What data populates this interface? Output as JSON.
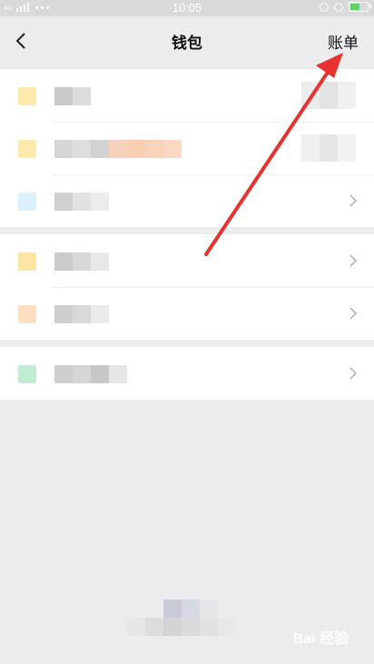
{
  "status_bar": {
    "time": "10:05",
    "network_label": "4G"
  },
  "nav": {
    "title": "钱包",
    "right_action": "账单",
    "back_icon": "chevron-left-icon"
  },
  "sections": [
    {
      "rows": [
        {
          "icon_color": "#ffd86b",
          "has_chevron": false
        },
        {
          "icon_color": "#ffd86b",
          "has_chevron": false
        },
        {
          "icon_color": "#bfe3ff",
          "has_chevron": true
        }
      ]
    },
    {
      "rows": [
        {
          "icon_color": "#ffd05a",
          "has_chevron": true
        },
        {
          "icon_color": "#ffc48f",
          "has_chevron": true
        }
      ]
    },
    {
      "rows": [
        {
          "icon_color": "#8fdcaf",
          "has_chevron": true
        }
      ]
    }
  ],
  "watermark": "Bai 经验",
  "colors": {
    "background": "#ececee",
    "annotation_arrow": "#e8322f",
    "battery": "#5fd16a"
  }
}
